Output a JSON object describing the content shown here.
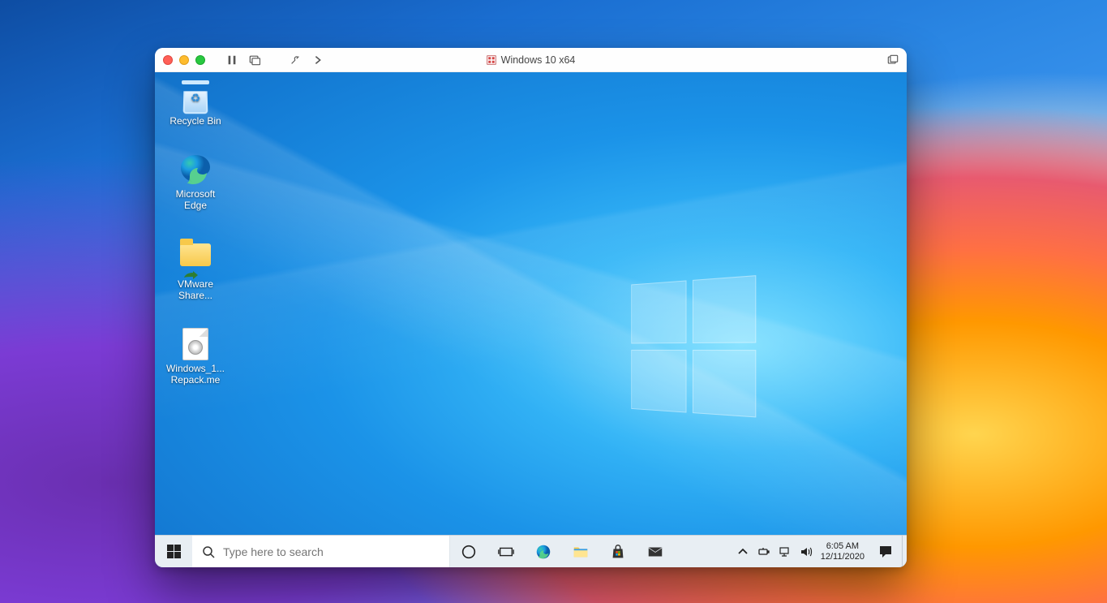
{
  "hostWallpaper": "macOS Big Sur",
  "window": {
    "title": "Windows 10 x64"
  },
  "desktop": {
    "icons": [
      {
        "id": "recycle-bin",
        "label": "Recycle Bin"
      },
      {
        "id": "edge",
        "label": "Microsoft\nEdge"
      },
      {
        "id": "vmware-share",
        "label": "VMware\nShare..."
      },
      {
        "id": "iso",
        "label": "Windows_1...\nRepack.me"
      }
    ]
  },
  "taskbar": {
    "searchPlaceholder": "Type here to search",
    "clock": {
      "time": "6:05 AM",
      "date": "12/11/2020"
    },
    "pinned": [
      {
        "id": "cortana"
      },
      {
        "id": "taskview"
      },
      {
        "id": "edge"
      },
      {
        "id": "explorer"
      },
      {
        "id": "store"
      },
      {
        "id": "mail"
      }
    ]
  }
}
